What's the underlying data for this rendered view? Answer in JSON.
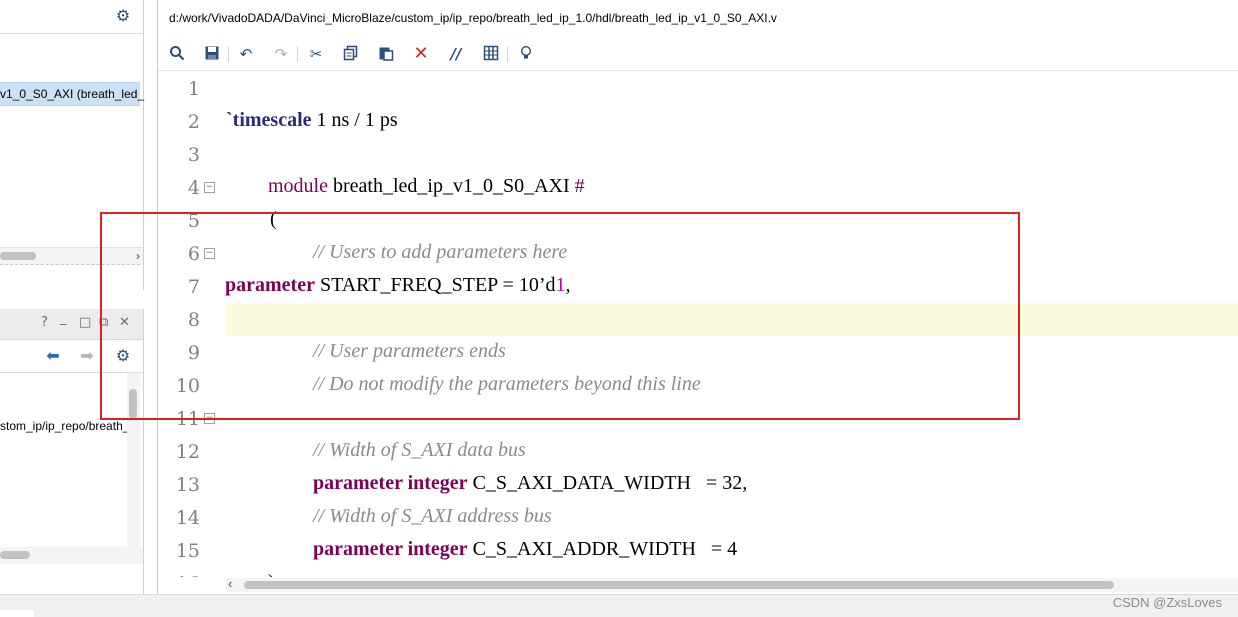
{
  "left_top_panel": {
    "selected_item": "v1_0_S0_AXI (breath_led_"
  },
  "left_bottom_panel": {
    "title_buttons": [
      "?",
      "_",
      "□",
      "⧉",
      "✕"
    ],
    "path_text": "stom_ip/ip_repo/breath_"
  },
  "editor": {
    "file_path": "d:/work/VivadoDADA/DaVinci_MicroBlaze/custom_ip/ip_repo/breath_led_ip_1.0/hdl/breath_led_ip_v1_0_S0_AXI.v",
    "toolbar_icons": [
      "search-icon",
      "save-icon",
      "undo-icon",
      "redo-icon",
      "cut-icon",
      "copy-icon",
      "paste-icon",
      "delete-icon",
      "comment-icon",
      "columns-icon",
      "lightbulb-icon"
    ],
    "line_numbers": [
      "1",
      "2",
      "3",
      "4",
      "5",
      "6",
      "7",
      "8",
      "9",
      "10",
      "11",
      "12",
      "13",
      "14",
      "15"
    ],
    "lines": {
      "l2_dir": "`timescale",
      "l2_rest": " 1 ns / 1 ps",
      "l4_kw": "module",
      "l4_name": " breath_led_ip_v1_0_S0_AXI ",
      "l4_hash": "#",
      "l5": "(",
      "l6": "// Users to add parameters here",
      "l7_kw": "parameter",
      "l7_rest": " START_FREQ_STEP = 10’d",
      "l7_mag": "1",
      "l7_end": ",",
      "l9": "// User parameters ends",
      "l10": "// Do not modify the parameters beyond this line",
      "l12": "// Width of S_AXI data bus",
      "l13_kw": "parameter integer",
      "l13_rest": " C_S_AXI_DATA_WIDTH   = 32,",
      "l14": "// Width of S_AXI address bus",
      "l15_kw": "parameter integer",
      "l15_rest": " C_S_AXI_ADDR_WIDTH   = 4"
    }
  },
  "watermark": "CSDN @ZxsLoves",
  "colors": {
    "accent_icon": "#2b4f7a",
    "keyword": "#7f0055",
    "comment": "#8a8a8a",
    "highlight_line": "#fbfbdf",
    "annotation_box": "#e02020",
    "selection": "#cce0f6"
  }
}
